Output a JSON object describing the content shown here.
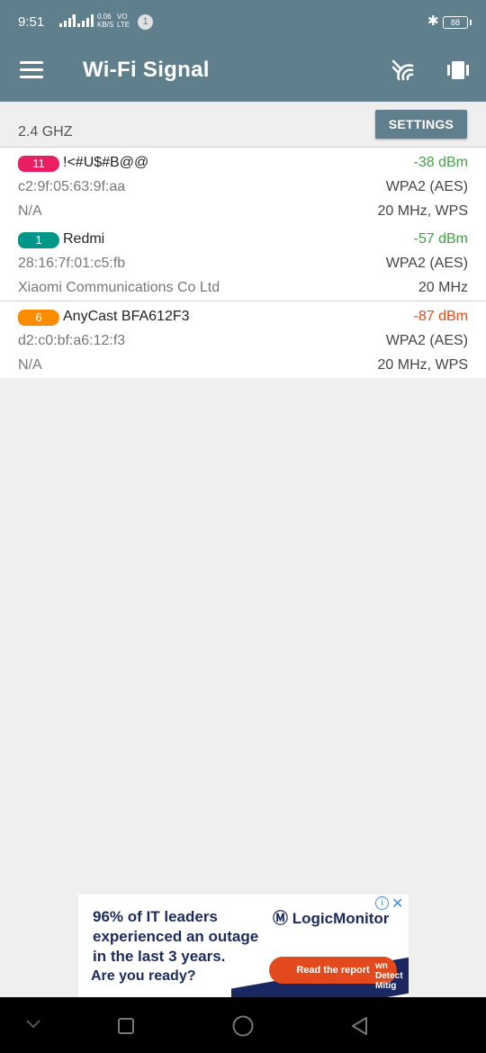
{
  "status_bar": {
    "time": "9:51",
    "net_small": "ᴴ",
    "speed_value": "0.06",
    "speed_unit": "KB/S",
    "volte_top": "VO",
    "volte_bottom": "LTE",
    "notification_count": "1",
    "battery": "88"
  },
  "app_bar": {
    "title": "Wi-Fi Signal",
    "icons": [
      "menu-icon",
      "wifi-scan-icon",
      "vibrate-icon"
    ]
  },
  "band": {
    "label": "2.4 GHZ",
    "settings_label": "SETTINGS"
  },
  "networks": [
    {
      "channel": "11",
      "channel_color": "#e91e63",
      "ssid": "!<#U$#B@@",
      "signal": "-38 dBm",
      "signal_color": "#43a047",
      "bssid": "c2:9f:05:63:9f:aa",
      "security": "WPA2 (AES)",
      "vendor": "N/A",
      "width": "20 MHz, WPS"
    },
    {
      "channel": "1",
      "channel_color": "#009688",
      "ssid": "Redmi",
      "signal": "-57 dBm",
      "signal_color": "#43a047",
      "bssid": "28:16:7f:01:c5:fb",
      "security": "WPA2 (AES)",
      "vendor": "Xiaomi Communications Co Ltd",
      "width": "20 MHz"
    },
    {
      "channel": "6",
      "channel_color": "#fb8c00",
      "ssid": "AnyCast BFA612F3",
      "signal": "-87 dBm",
      "signal_color": "#e64a19",
      "bssid": "d2:c0:bf:a6:12:f3",
      "security": "WPA2 (AES)",
      "vendor": "N/A",
      "width": "20 MHz, WPS"
    }
  ],
  "ad": {
    "headline_1": "96% of IT leaders",
    "headline_2": "experienced an outage",
    "headline_3": "in the last 3 years.",
    "sub": "Are you ready?",
    "brand": "LogicMonitor",
    "cta": "Read the report",
    "side_1": "wn",
    "side_2": "Detect",
    "side_3": "Mitig"
  },
  "nav_bar": {
    "icons": [
      "collapse-icon",
      "recents-icon",
      "home-icon",
      "back-icon"
    ]
  }
}
